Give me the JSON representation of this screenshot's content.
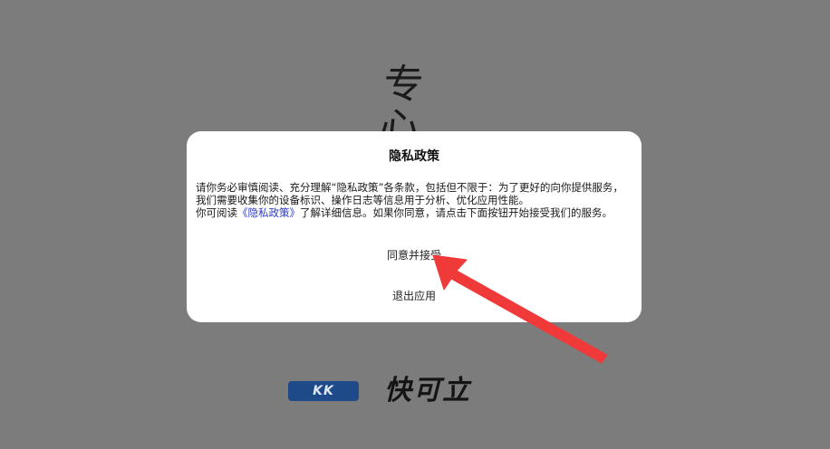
{
  "splash": {
    "slogan": "专心·",
    "logo_mark": "KK",
    "logo_text": "快可立"
  },
  "dialog": {
    "title": "隐私政策",
    "body_line1": "请你务必审慎阅读、充分理解“隐私政策”各条款，包括但不限于：为了更好的向你提供服务，我们需要收集你的设备标识、操作日志等信息用于分析、优化应用性能。",
    "body_line2_prefix": "你可阅读",
    "policy_link": "《隐私政策》",
    "body_line2_suffix": "了解详细信息。如果你同意，请点击下面按钮开始接受我们的服务。",
    "agree_button": "同意并接受",
    "exit_button": "退出应用"
  },
  "colors": {
    "backdrop": "#7c7c7c",
    "dialog_bg": "#ffffff",
    "link": "#2b39c9",
    "annotation_arrow": "#f03a3a",
    "logo_mark_bg": "#1e4a8a"
  },
  "icons": {
    "annotation": "red-arrow-pointer"
  }
}
